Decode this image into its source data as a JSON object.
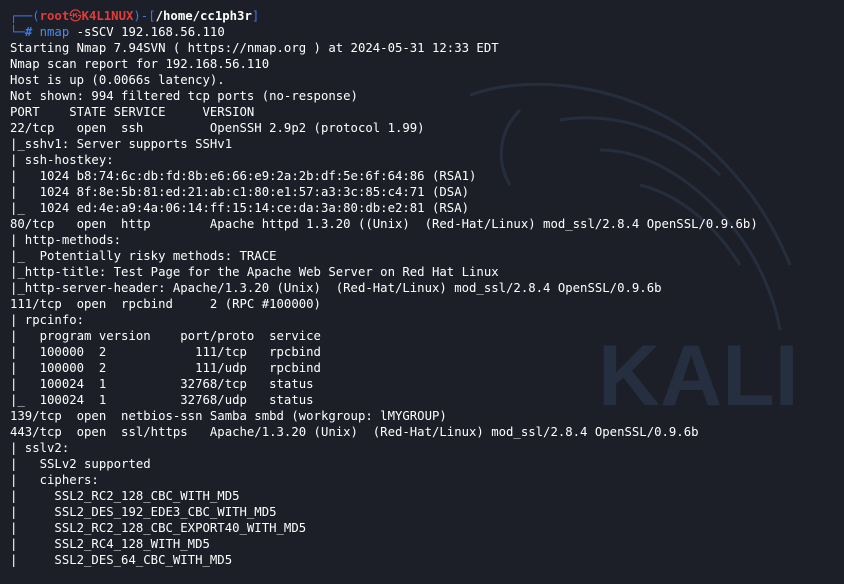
{
  "prompt": {
    "user": "root",
    "symbol": "㉿",
    "host": "K4L1NUX",
    "path": "/home/cc1ph3r",
    "command": "nmap",
    "args": " -sSCV 192.168.56.110"
  },
  "watermark": {
    "text": "KALI",
    "color": "#3a4a66"
  },
  "output_lines": [
    "Starting Nmap 7.94SVN ( https://nmap.org ) at 2024-05-31 12:33 EDT",
    "Nmap scan report for 192.168.56.110",
    "Host is up (0.0066s latency).",
    "Not shown: 994 filtered tcp ports (no-response)",
    "PORT    STATE SERVICE     VERSION",
    "22/tcp   open  ssh         OpenSSH 2.9p2 (protocol 1.99)",
    "|_sshv1: Server supports SSHv1",
    "| ssh-hostkey:",
    "|   1024 b8:74:6c:db:fd:8b:e6:66:e9:2a:2b:df:5e:6f:64:86 (RSA1)",
    "|   1024 8f:8e:5b:81:ed:21:ab:c1:80:e1:57:a3:3c:85:c4:71 (DSA)",
    "|_  1024 ed:4e:a9:4a:06:14:ff:15:14:ce:da:3a:80:db:e2:81 (RSA)",
    "80/tcp   open  http        Apache httpd 1.3.20 ((Unix)  (Red-Hat/Linux) mod_ssl/2.8.4 OpenSSL/0.9.6b)",
    "| http-methods:",
    "|_  Potentially risky methods: TRACE",
    "|_http-title: Test Page for the Apache Web Server on Red Hat Linux",
    "|_http-server-header: Apache/1.3.20 (Unix)  (Red-Hat/Linux) mod_ssl/2.8.4 OpenSSL/0.9.6b",
    "111/tcp  open  rpcbind     2 (RPC #100000)",
    "| rpcinfo:",
    "|   program version    port/proto  service",
    "|   100000  2            111/tcp   rpcbind",
    "|   100000  2            111/udp   rpcbind",
    "|   100024  1          32768/tcp   status",
    "|_  100024  1          32768/udp   status",
    "139/tcp  open  netbios-ssn Samba smbd (workgroup: lMYGROUP)",
    "443/tcp  open  ssl/https   Apache/1.3.20 (Unix)  (Red-Hat/Linux) mod_ssl/2.8.4 OpenSSL/0.9.6b",
    "| sslv2:",
    "|   SSLv2 supported",
    "|   ciphers:",
    "|     SSL2_RC2_128_CBC_WITH_MD5",
    "|     SSL2_DES_192_EDE3_CBC_WITH_MD5",
    "|     SSL2_RC2_128_CBC_EXPORT40_WITH_MD5",
    "|     SSL2_RC4_128_WITH_MD5",
    "|     SSL2_DES_64_CBC_WITH_MD5"
  ]
}
